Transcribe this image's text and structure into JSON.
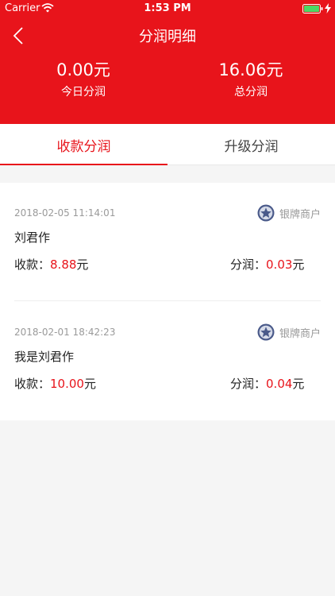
{
  "status_bar": {
    "carrier": "Carrier",
    "time": "1:53 PM",
    "icons": [
      "wifi-icon",
      "battery-icon",
      "charging-bolt-icon"
    ]
  },
  "header": {
    "back_icon": "chevron-left-icon",
    "title": "分润明细",
    "today_value": "0.00元",
    "today_label": "今日分润",
    "total_value": "16.06元",
    "total_label": "总分润",
    "background_color": "#e8141b"
  },
  "tabs": [
    {
      "label": "收款分润",
      "active": true
    },
    {
      "label": "升级分润",
      "active": false
    }
  ],
  "records": [
    {
      "time": "2018-02-05  11:14:01",
      "badge_icon": "star-medal-icon",
      "badge": "银牌商户",
      "name": "刘君作",
      "pay_label": "收款：",
      "pay_value": "8.88",
      "pay_unit": "元",
      "share_label": "分润：",
      "share_value": "0.03",
      "share_unit": "元"
    },
    {
      "time": "2018-02-01  18:42:23",
      "badge_icon": "star-medal-icon",
      "badge": "银牌商户",
      "name": "我是刘君作",
      "pay_label": "收款：",
      "pay_value": "10.00",
      "pay_unit": "元",
      "share_label": "分润：",
      "share_value": "0.04",
      "share_unit": "元"
    }
  ],
  "colors": {
    "accent": "#e8141b",
    "background": "#f5f5f5",
    "muted_text": "#9a9a9a",
    "badge_icon": "#4a5a8a"
  }
}
